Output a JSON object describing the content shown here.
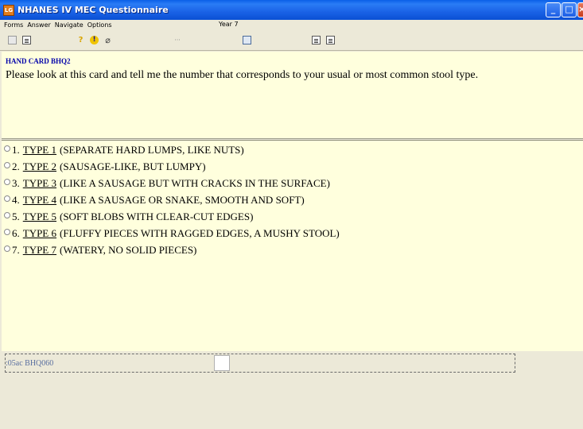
{
  "window": {
    "icon_text": "LG",
    "title": "NHANES IV MEC Questionnaire",
    "minimize": "_",
    "maximize": "□",
    "close": "×"
  },
  "menubar": {
    "items": [
      "Forms",
      "Answer",
      "Navigate",
      "Options"
    ],
    "center_text": "Year 7"
  },
  "toolbar": {
    "icons": [
      "copy-icon",
      "document-icon",
      "help-icon",
      "info-icon",
      "attachment-icon",
      "more-icon",
      "search-document-icon",
      "prev-document-icon",
      "next-document-icon"
    ],
    "help_glyph": "?",
    "info_glyph": "!",
    "clip_glyph": "⌀",
    "dots_glyph": "···"
  },
  "question": {
    "code": "HAND CARD BHQ2",
    "text": "Please look at this card and tell me the number that corresponds to your usual or most common stool type."
  },
  "options": [
    {
      "num": "1.",
      "type": "TYPE 1",
      "desc": "(SEPARATE HARD LUMPS, LIKE NUTS)"
    },
    {
      "num": "2.",
      "type": "TYPE 2",
      "desc": "(SAUSAGE-LIKE, BUT LUMPY)"
    },
    {
      "num": "3.",
      "type": "TYPE 3",
      "desc": "(LIKE A SAUSAGE BUT WITH CRACKS IN THE SURFACE)"
    },
    {
      "num": "4.",
      "type": "TYPE 4",
      "desc": "(LIKE A SAUSAGE OR SNAKE, SMOOTH AND SOFT)"
    },
    {
      "num": "5.",
      "type": "TYPE 5",
      "desc": "(SOFT BLOBS WITH CLEAR-CUT EDGES)"
    },
    {
      "num": "6.",
      "type": "TYPE 6",
      "desc": "(FLUFFY PIECES WITH RAGGED EDGES, A MUSHY STOOL)"
    },
    {
      "num": "7.",
      "type": "TYPE 7",
      "desc": "(WATERY, NO SOLID PIECES)"
    }
  ],
  "status": {
    "code": ":05ac BHQ060",
    "answer_value": ""
  }
}
